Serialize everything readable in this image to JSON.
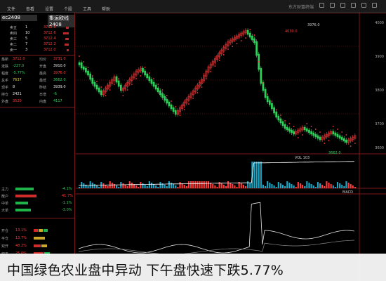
{
  "menubar": {
    "items": [
      "文件",
      "查看",
      "设置",
      "个股",
      "工具",
      "帮助"
    ],
    "window_title": "东方财富终端"
  },
  "quote": {
    "title": "集运欧线2408",
    "code": "ec2408",
    "orderbook": [
      {
        "label": "卖五",
        "qty": "1",
        "price": "3712.8"
      },
      {
        "label": "卖四",
        "qty": "10",
        "price": "3712.6"
      },
      {
        "label": "卖三",
        "qty": "5",
        "price": "3712.4"
      },
      {
        "label": "卖二",
        "qty": "7",
        "price": "3712.2"
      },
      {
        "label": "卖一",
        "qty": "3",
        "price": "3712.0"
      }
    ],
    "rows": [
      {
        "l": "最新",
        "v": "3712.0",
        "l2": "均价",
        "v2": "3731.0"
      },
      {
        "l": "涨跌",
        "v": "-227.0",
        "l2": "开盘",
        "v2": "3910.0"
      },
      {
        "l": "幅度",
        "v": "-5.77%",
        "l2": "最高",
        "v2": "3976.0"
      },
      {
        "l": "总手",
        "v": "7637",
        "l2": "最低",
        "v2": "3662.0"
      },
      {
        "l": "现手",
        "v": "8",
        "l2": "昨结",
        "v2": "3939.0"
      },
      {
        "l": "持仓",
        "v": "2421",
        "l2": "日增",
        "v2": "-6"
      },
      {
        "l": "外盘",
        "v": "3520",
        "l2": "内盘",
        "v2": "4117"
      }
    ],
    "flow": [
      {
        "label": "主力",
        "value": "-4.1%"
      },
      {
        "label": "散户",
        "value": "41.7%"
      },
      {
        "label": "中单",
        "value": "-1.1%"
      },
      {
        "label": "大单",
        "value": "-3.0%"
      }
    ],
    "bottom": [
      {
        "label": "开仓",
        "value": "13.1%"
      },
      {
        "label": "平仓",
        "value": "13.7%"
      },
      {
        "label": "双开",
        "value": "48.2%"
      },
      {
        "label": "双平",
        "value": "25.0%"
      }
    ]
  },
  "chart": {
    "top_right_label": "3976.0",
    "right_axis": [
      "4000",
      "3900",
      "3800",
      "3700",
      "3600"
    ],
    "vol_label": "VOL 103",
    "low_label": "3662.0",
    "high_label": "4030.0",
    "indicator_label": "MACD"
  },
  "caption": {
    "text": "中国绿色农业盘中异动 下午盘快速下跌5.77%"
  },
  "colors": {
    "up": "#ff3b3b",
    "down": "#2fd25a",
    "price_line": "#ffffff",
    "background": "#000000"
  }
}
